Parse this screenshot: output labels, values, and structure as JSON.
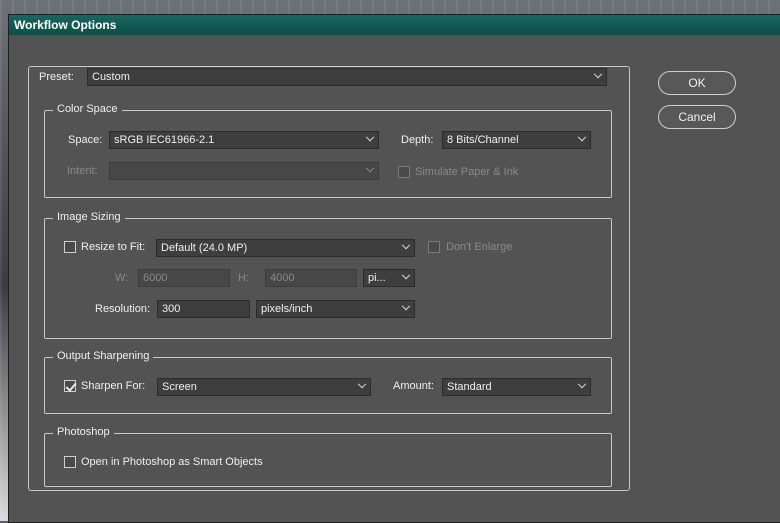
{
  "window": {
    "title": "Workflow Options"
  },
  "preset": {
    "label": "Preset:",
    "value": "Custom"
  },
  "buttons": {
    "ok": "OK",
    "cancel": "Cancel"
  },
  "color_space": {
    "title": "Color Space",
    "space_label": "Space:",
    "space_value": "sRGB IEC61966-2.1",
    "depth_label": "Depth:",
    "depth_value": "8 Bits/Channel",
    "intent_label": "Intent:",
    "intent_value": "",
    "simulate_label": "Simulate Paper & Ink",
    "simulate_checked": false
  },
  "image_sizing": {
    "title": "Image Sizing",
    "resize_label": "Resize to Fit:",
    "resize_checked": false,
    "resize_value": "Default  (24.0 MP)",
    "dont_enlarge_label": "Don't Enlarge",
    "dont_enlarge_checked": false,
    "w_label": "W:",
    "w_value": "6000",
    "h_label": "H:",
    "h_value": "4000",
    "unit_value": "pi...",
    "resolution_label": "Resolution:",
    "resolution_value": "300",
    "resolution_unit": "pixels/inch"
  },
  "output_sharpening": {
    "title": "Output Sharpening",
    "sharpen_label": "Sharpen For:",
    "sharpen_checked": true,
    "sharpen_value": "Screen",
    "amount_label": "Amount:",
    "amount_value": "Standard"
  },
  "photoshop": {
    "title": "Photoshop",
    "smart_objects_label": "Open in Photoshop as Smart Objects",
    "smart_objects_checked": false
  }
}
